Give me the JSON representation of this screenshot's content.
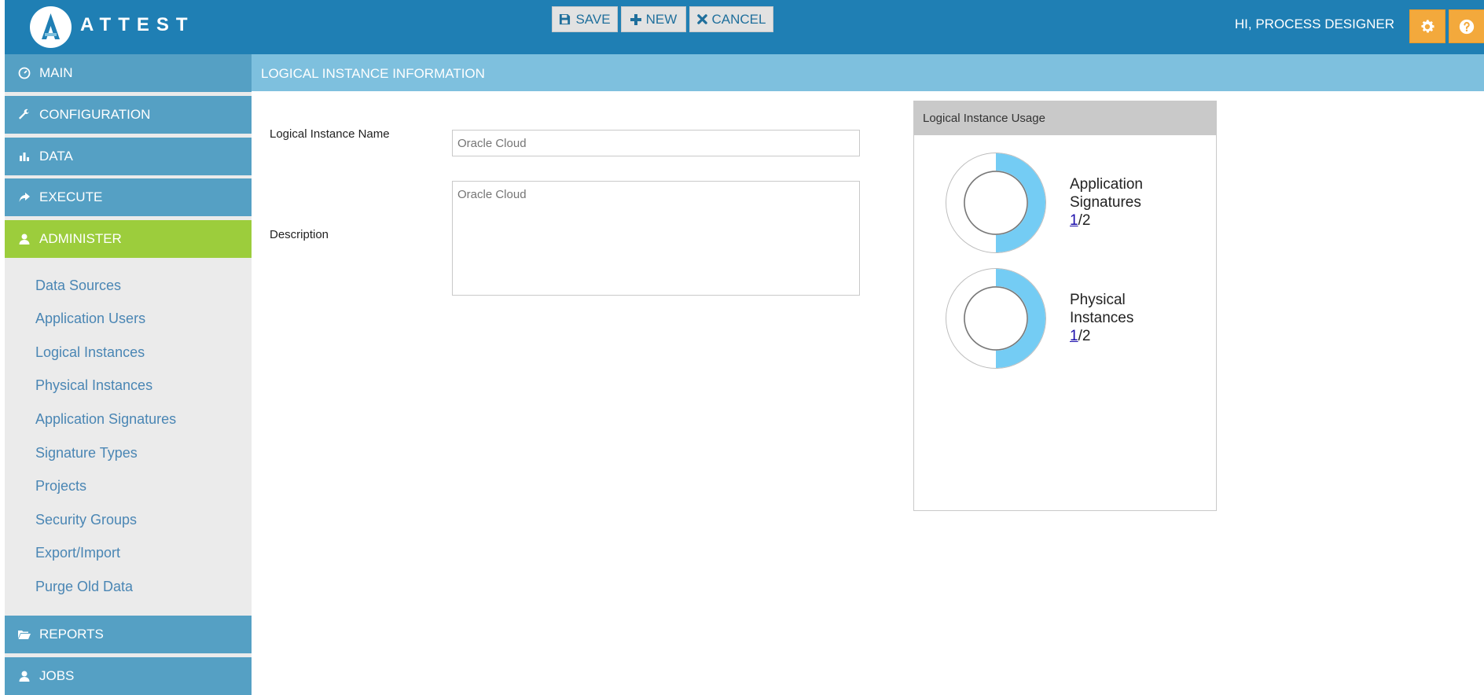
{
  "header": {
    "brand": "ATTEST",
    "greeting": "HI, PROCESS DESIGNER",
    "icons": {
      "settings": "gear-icon",
      "help": "question-icon"
    },
    "colors": {
      "bar": "#1f7fb4",
      "action": "#f3a93c"
    }
  },
  "sidebar": {
    "sections": [
      {
        "label": "MAIN",
        "icon": "dashboard-icon"
      },
      {
        "label": "CONFIGURATION",
        "icon": "wrench-icon"
      },
      {
        "label": "DATA",
        "icon": "bar-chart-icon"
      },
      {
        "label": "EXECUTE",
        "icon": "share-arrow-icon"
      },
      {
        "label": "ADMINISTER",
        "icon": "user-icon",
        "active": true
      },
      {
        "label": "REPORTS",
        "icon": "folder-open-icon"
      },
      {
        "label": "JOBS",
        "icon": "user-icon"
      }
    ],
    "admin_items": [
      "Data Sources",
      "Application Users",
      "Logical Instances",
      "Physical Instances",
      "Application Signatures",
      "Signature Types",
      "Projects",
      "Security Groups",
      "Export/Import",
      "Purge Old Data"
    ],
    "colors": {
      "section": "#55a0c4",
      "active": "#9ccd3c",
      "link": "#4a86b4"
    }
  },
  "toolbar": {
    "title": "LOGICAL INSTANCE INFORMATION",
    "save_label": "SAVE",
    "new_label": "NEW",
    "cancel_label": "CANCEL"
  },
  "form": {
    "name_label": "Logical Instance Name",
    "name_placeholder": "Oracle Cloud",
    "description_label": "Description",
    "description_placeholder": "Oracle Cloud"
  },
  "usage": {
    "title": "Logical Instance Usage",
    "items": [
      {
        "label_line1": "Application",
        "label_line2": "Signatures",
        "used": "1",
        "total": "/2",
        "fraction": 0.5
      },
      {
        "label_line1": "Physical",
        "label_line2": "Instances",
        "used": "1",
        "total": "/2",
        "fraction": 0.5
      }
    ],
    "colors": {
      "filled": "#74ccf4",
      "empty": "#ffffff"
    }
  }
}
